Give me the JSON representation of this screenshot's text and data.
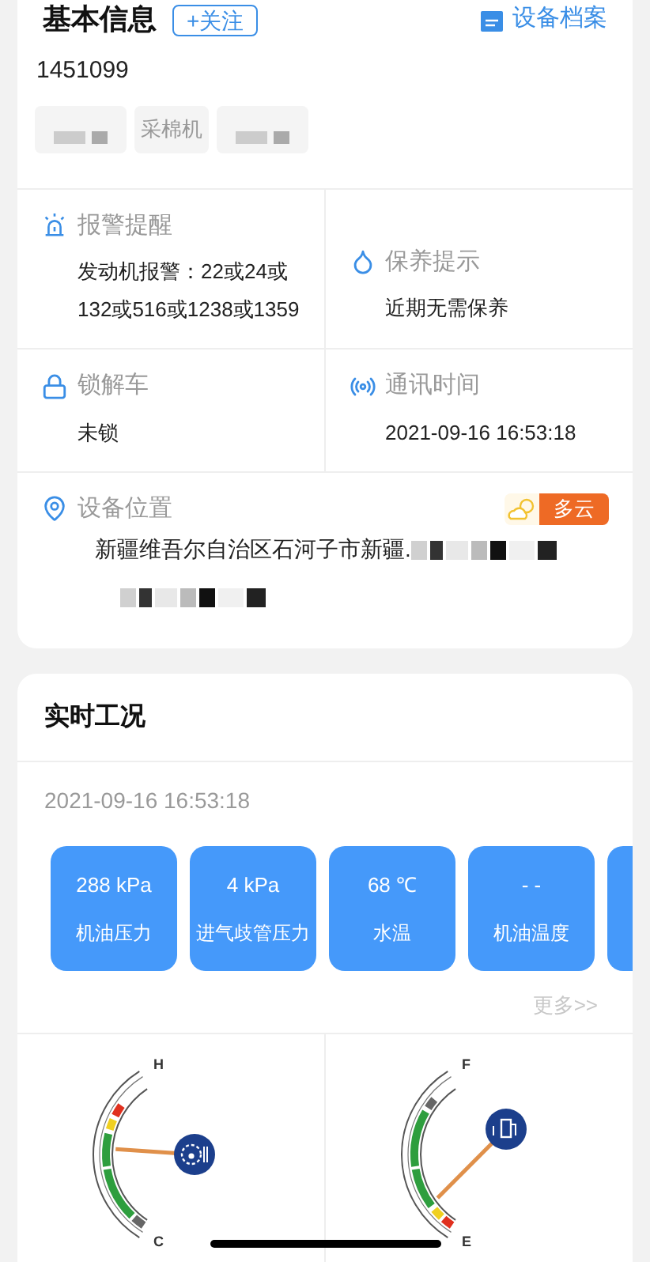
{
  "basic_info": {
    "title": "基本信息",
    "follow_button": "+关注",
    "archive_link": "设备档案",
    "device_id": "1451099",
    "tags": [
      {
        "kind": "redacted"
      },
      {
        "kind": "text",
        "label": "采棉机"
      },
      {
        "kind": "redacted"
      }
    ]
  },
  "status_items": [
    {
      "kind": "alarm",
      "title": "报警提醒",
      "value": "发动机报警：22或24或132或516或1238或1359"
    },
    {
      "kind": "maintenance",
      "title": "保养提示",
      "value": "近期无需保养"
    },
    {
      "kind": "lock",
      "title": "锁解车",
      "value": "未锁"
    },
    {
      "kind": "signal",
      "title": "通讯时间",
      "value": "2021-09-16 16:53:18"
    }
  ],
  "location": {
    "title": "设备位置",
    "weather": "多云",
    "address": "新疆维吾尔自治区石河子市新疆."
  },
  "realtime": {
    "title": "实时工况",
    "timestamp": "2021-09-16 16:53:18",
    "metrics": [
      {
        "value": "288 kPa",
        "label": "机油压力"
      },
      {
        "value": "4 kPa",
        "label": "进气歧管压力"
      },
      {
        "value": "68 ℃",
        "label": "水温"
      },
      {
        "value": "- -",
        "label": "机油温度"
      }
    ],
    "more_link": "更多>>",
    "gauges": [
      {
        "kind": "temperature",
        "top": "H",
        "bottom": "C"
      },
      {
        "kind": "fuel",
        "top": "F",
        "bottom": "E"
      }
    ]
  }
}
